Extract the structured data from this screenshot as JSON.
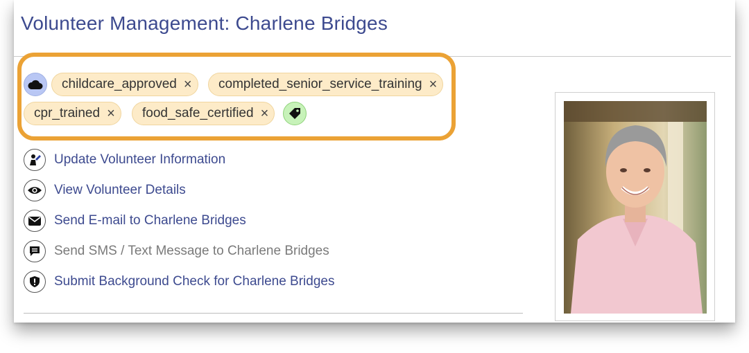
{
  "page": {
    "title": "Volunteer Management: Charlene Bridges"
  },
  "tags": {
    "cloud_icon": "cloud-icon",
    "add_tag_icon": "tag-icon",
    "items": [
      {
        "label": "childcare_approved",
        "remove": "×"
      },
      {
        "label": "completed_senior_service_training",
        "remove": "×"
      },
      {
        "label": "cpr_trained",
        "remove": "×"
      },
      {
        "label": "food_safe_certified",
        "remove": "×"
      }
    ],
    "highlight_color": "#eba235"
  },
  "actions": [
    {
      "label": "Update Volunteer Information",
      "icon": "person-edit-icon",
      "enabled": true
    },
    {
      "label": "View Volunteer Details",
      "icon": "eye-icon",
      "enabled": true
    },
    {
      "label": "Send E-mail to Charlene Bridges",
      "icon": "envelope-icon",
      "enabled": true
    },
    {
      "label": "Send SMS / Text Message to Charlene Bridges",
      "icon": "chat-icon",
      "enabled": false
    },
    {
      "label": "Submit Background Check for Charlene Bridges",
      "icon": "shield-icon",
      "enabled": true
    }
  ],
  "colors": {
    "link": "#3d4a8f",
    "disabled": "#7a7a7a",
    "tag_bg": "#fdebc8",
    "cloud_bg": "#b9c7f4",
    "add_tag_bg": "#c7f2b9"
  },
  "profile": {
    "photo_icon": "volunteer-photo"
  }
}
